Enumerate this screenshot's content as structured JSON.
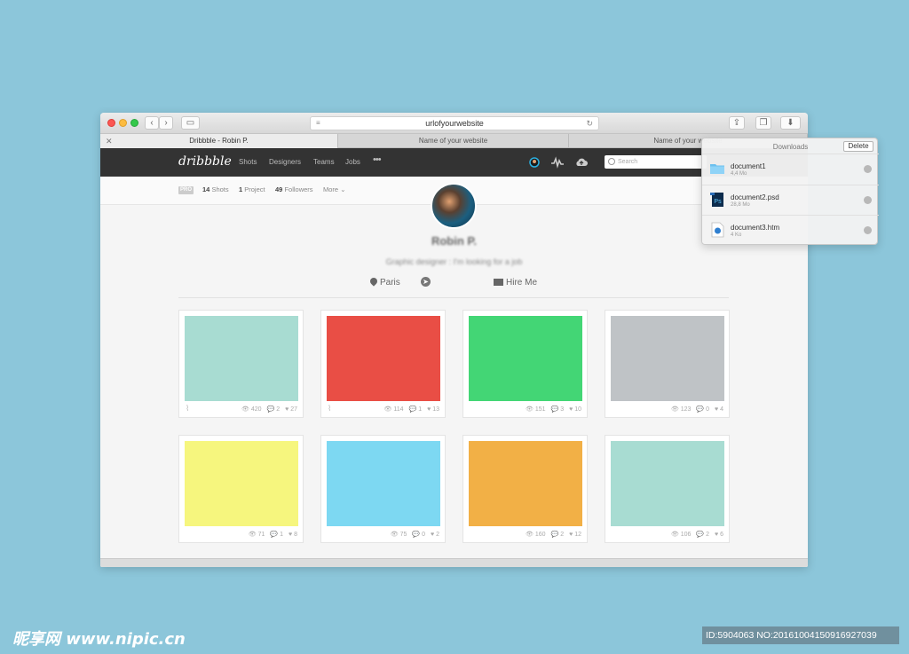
{
  "browser": {
    "url": "urlofyourwebsite",
    "tabs": [
      {
        "label": "Dribbble  -  Robin P."
      },
      {
        "label": "Name of your website"
      },
      {
        "label": "Name of your website"
      }
    ]
  },
  "nav": {
    "logo": "dribbble",
    "links": [
      "Shots",
      "Designers",
      "Teams",
      "Jobs"
    ],
    "more": "•••",
    "search_placeholder": "Search"
  },
  "profile": {
    "badge": "PRO",
    "shots_count": "14",
    "shots_label": "Shots",
    "projects_count": "1",
    "projects_label": "Project",
    "followers_count": "49",
    "followers_label": "Followers",
    "more": "More",
    "name": "Robin P.",
    "bio": "Graphic designer : I'm looking for a job",
    "location": "Paris",
    "hire": "Hire Me"
  },
  "shots": [
    {
      "color": "#a8dcd2",
      "views": "420",
      "comments": "2",
      "likes": "27",
      "attachment": true
    },
    {
      "color": "#e94e45",
      "views": "114",
      "comments": "1",
      "likes": "13",
      "attachment": true
    },
    {
      "color": "#43d675",
      "views": "151",
      "comments": "3",
      "likes": "10",
      "attachment": false
    },
    {
      "color": "#bfc3c6",
      "views": "123",
      "comments": "0",
      "likes": "4",
      "attachment": false
    },
    {
      "color": "#f6f67e",
      "views": "71",
      "comments": "1",
      "likes": "8",
      "attachment": false
    },
    {
      "color": "#7dd8f2",
      "views": "75",
      "comments": "0",
      "likes": "2",
      "attachment": false
    },
    {
      "color": "#f2b046",
      "views": "160",
      "comments": "2",
      "likes": "12",
      "attachment": false
    },
    {
      "color": "#a8dcd2",
      "views": "106",
      "comments": "2",
      "likes": "6",
      "attachment": false
    }
  ],
  "downloads": {
    "title": "Downloads",
    "delete": "Delete",
    "items": [
      {
        "name": "document1",
        "size": "4,4 Mo",
        "icon": "folder-icon"
      },
      {
        "name": "document2.psd",
        "size": "28,8 Mo",
        "icon": "photoshop-file-icon"
      },
      {
        "name": "document3.htm",
        "size": "4 Ko",
        "icon": "html-file-icon"
      }
    ]
  },
  "watermark": {
    "site": "昵享网 www.nipic.cn",
    "id": "ID:5904063 NO:20161004150916927039"
  }
}
